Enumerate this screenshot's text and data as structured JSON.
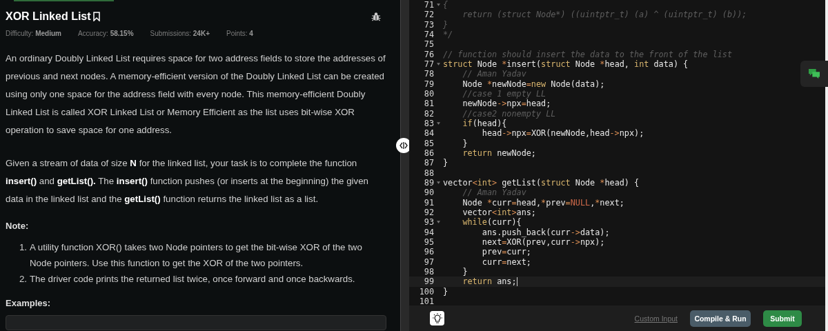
{
  "problem": {
    "title": "XOR Linked List",
    "stats": [
      {
        "label": "Difficulty:",
        "value": "Medium"
      },
      {
        "label": "Accuracy:",
        "value": "58.15%"
      },
      {
        "label": "Submissions:",
        "value": "24K+"
      },
      {
        "label": "Points:",
        "value": "4"
      }
    ],
    "paragraphs": [
      "An ordinary Doubly Linked List requires space for two address fields to store the addresses of previous and next nodes. A memory-efficient version of the Doubly Linked List can be created using only one space for the address field with every node. This memory-efficient Doubly Linked List is called XOR Linked List or Memory Efficient as the list uses bit-wise XOR operation to save space for one address.",
      "Given a stream of data of size **N** for the linked list, your task is to complete the function **insert()** and **getList().** The **insert()** function pushes (or inserts at the beginning) the given data in the linked list and the **getList()**  function returns the linked list as a list."
    ],
    "note_heading": "Note:",
    "notes": [
      {
        "marker": "1.",
        "text": "A utility function XOR() takes two Node pointers to get the bit-wise XOR of the two Node pointers. Use this function to get the XOR of the two pointers."
      },
      {
        "marker": "2.",
        "text": "The driver code prints the returned list twice, once forward and once backwards."
      }
    ],
    "examples_heading": "Examples:"
  },
  "editor": {
    "lines": [
      {
        "number": "71",
        "fold": true,
        "current": false,
        "tokens": [
          {
            "kind": "comment",
            "text": "{"
          }
        ]
      },
      {
        "number": "72",
        "fold": false,
        "current": false,
        "tokens": [
          {
            "kind": "comment",
            "text": "    return (struct Node*) ((uintptr_t) (a) ^ (uintptr_t) (b));"
          }
        ]
      },
      {
        "number": "73",
        "fold": false,
        "current": false,
        "tokens": [
          {
            "kind": "comment",
            "text": "}"
          }
        ]
      },
      {
        "number": "74",
        "fold": false,
        "current": false,
        "tokens": [
          {
            "kind": "comment",
            "text": "*/"
          }
        ]
      },
      {
        "number": "75",
        "fold": false,
        "current": false
      },
      {
        "number": "76",
        "fold": false,
        "current": false,
        "tokens": [
          {
            "kind": "comment",
            "text": "// function should insert the data to the front of the list"
          }
        ]
      },
      {
        "number": "77",
        "fold": true,
        "current": false,
        "tokens": [
          {
            "kind": "keyword",
            "text": "struct"
          },
          {
            "kind": "plain",
            "text": " Node "
          },
          {
            "kind": "operator",
            "text": "*"
          },
          {
            "kind": "plain",
            "text": "insert("
          },
          {
            "kind": "keyword",
            "text": "struct"
          },
          {
            "kind": "plain",
            "text": " Node "
          },
          {
            "kind": "operator",
            "text": "*"
          },
          {
            "kind": "plain",
            "text": "head, "
          },
          {
            "kind": "keyword",
            "text": "int"
          },
          {
            "kind": "plain",
            "text": " data) {"
          }
        ]
      },
      {
        "number": "78",
        "fold": false,
        "current": false,
        "tokens": [
          {
            "kind": "comment",
            "text": "    // Aman Yadav"
          }
        ]
      },
      {
        "number": "79",
        "fold": false,
        "current": false,
        "tokens": [
          {
            "kind": "plain",
            "text": "    Node "
          },
          {
            "kind": "operator",
            "text": "*"
          },
          {
            "kind": "plain",
            "text": "newNode"
          },
          {
            "kind": "operator",
            "text": "="
          },
          {
            "kind": "keyword",
            "text": "new"
          },
          {
            "kind": "plain",
            "text": " Node(data);"
          }
        ]
      },
      {
        "number": "80",
        "fold": false,
        "current": false,
        "tokens": [
          {
            "kind": "comment",
            "text": "    //case 1 empty LL"
          }
        ]
      },
      {
        "number": "81",
        "fold": false,
        "current": false,
        "tokens": [
          {
            "kind": "plain",
            "text": "    newNode"
          },
          {
            "kind": "operator",
            "text": "->"
          },
          {
            "kind": "plain",
            "text": "npx"
          },
          {
            "kind": "operator",
            "text": "="
          },
          {
            "kind": "plain",
            "text": "head;"
          }
        ]
      },
      {
        "number": "82",
        "fold": false,
        "current": false,
        "tokens": [
          {
            "kind": "comment",
            "text": "    //case2 nonempty LL"
          }
        ]
      },
      {
        "number": "83",
        "fold": true,
        "current": false,
        "tokens": [
          {
            "kind": "keyword",
            "text": "    if"
          },
          {
            "kind": "plain",
            "text": "(head){"
          }
        ]
      },
      {
        "number": "84",
        "fold": false,
        "current": false,
        "tokens": [
          {
            "kind": "plain",
            "text": "        head"
          },
          {
            "kind": "operator",
            "text": "->"
          },
          {
            "kind": "plain",
            "text": "npx"
          },
          {
            "kind": "operator",
            "text": "="
          },
          {
            "kind": "plain",
            "text": "XOR(newNode,head"
          },
          {
            "kind": "operator",
            "text": "->"
          },
          {
            "kind": "plain",
            "text": "npx);"
          }
        ]
      },
      {
        "number": "85",
        "fold": false,
        "current": false,
        "tokens": [
          {
            "kind": "plain",
            "text": "    }"
          }
        ]
      },
      {
        "number": "86",
        "fold": false,
        "current": false,
        "tokens": [
          {
            "kind": "keyword",
            "text": "    return"
          },
          {
            "kind": "plain",
            "text": " newNode;"
          }
        ]
      },
      {
        "number": "87",
        "fold": false,
        "current": false,
        "tokens": [
          {
            "kind": "plain",
            "text": "}"
          }
        ]
      },
      {
        "number": "88",
        "fold": false,
        "current": false
      },
      {
        "number": "89",
        "fold": true,
        "current": false,
        "tokens": [
          {
            "kind": "plain",
            "text": "vector"
          },
          {
            "kind": "operator",
            "text": "<"
          },
          {
            "kind": "keyword",
            "text": "int"
          },
          {
            "kind": "operator",
            "text": ">"
          },
          {
            "kind": "plain",
            "text": " getList("
          },
          {
            "kind": "keyword",
            "text": "struct"
          },
          {
            "kind": "plain",
            "text": " Node "
          },
          {
            "kind": "operator",
            "text": "*"
          },
          {
            "kind": "plain",
            "text": "head) {"
          }
        ]
      },
      {
        "number": "90",
        "fold": false,
        "current": false,
        "tokens": [
          {
            "kind": "comment",
            "text": "    // Aman Yadav"
          }
        ]
      },
      {
        "number": "91",
        "fold": false,
        "current": false,
        "tokens": [
          {
            "kind": "plain",
            "text": "    Node "
          },
          {
            "kind": "operator",
            "text": "*"
          },
          {
            "kind": "plain",
            "text": "curr"
          },
          {
            "kind": "operator",
            "text": "="
          },
          {
            "kind": "plain",
            "text": "head,"
          },
          {
            "kind": "operator",
            "text": "*"
          },
          {
            "kind": "plain",
            "text": "prev"
          },
          {
            "kind": "operator",
            "text": "="
          },
          {
            "kind": "constant",
            "text": "NULL"
          },
          {
            "kind": "plain",
            "text": ","
          },
          {
            "kind": "operator",
            "text": "*"
          },
          {
            "kind": "plain",
            "text": "next;"
          }
        ]
      },
      {
        "number": "92",
        "fold": false,
        "current": false,
        "tokens": [
          {
            "kind": "plain",
            "text": "    vector"
          },
          {
            "kind": "operator",
            "text": "<"
          },
          {
            "kind": "keyword",
            "text": "int"
          },
          {
            "kind": "operator",
            "text": ">"
          },
          {
            "kind": "plain",
            "text": "ans;"
          }
        ]
      },
      {
        "number": "93",
        "fold": true,
        "current": false,
        "tokens": [
          {
            "kind": "keyword",
            "text": "    while"
          },
          {
            "kind": "plain",
            "text": "(curr){"
          }
        ]
      },
      {
        "number": "94",
        "fold": false,
        "current": false,
        "tokens": [
          {
            "kind": "plain",
            "text": "        ans.push_back(curr"
          },
          {
            "kind": "operator",
            "text": "->"
          },
          {
            "kind": "plain",
            "text": "data);"
          }
        ]
      },
      {
        "number": "95",
        "fold": false,
        "current": false,
        "tokens": [
          {
            "kind": "plain",
            "text": "        next"
          },
          {
            "kind": "operator",
            "text": "="
          },
          {
            "kind": "plain",
            "text": "XOR(prev,curr"
          },
          {
            "kind": "operator",
            "text": "->"
          },
          {
            "kind": "plain",
            "text": "npx);"
          }
        ]
      },
      {
        "number": "96",
        "fold": false,
        "current": false,
        "tokens": [
          {
            "kind": "plain",
            "text": "        prev"
          },
          {
            "kind": "operator",
            "text": "="
          },
          {
            "kind": "plain",
            "text": "curr;"
          }
        ]
      },
      {
        "number": "97",
        "fold": false,
        "current": false,
        "tokens": [
          {
            "kind": "plain",
            "text": "        curr"
          },
          {
            "kind": "operator",
            "text": "="
          },
          {
            "kind": "plain",
            "text": "next;"
          }
        ]
      },
      {
        "number": "98",
        "fold": false,
        "current": false,
        "tokens": [
          {
            "kind": "plain",
            "text": "    }"
          }
        ]
      },
      {
        "number": "99",
        "fold": false,
        "current": true,
        "tokens": [
          {
            "kind": "keyword",
            "text": "    return"
          },
          {
            "kind": "plain",
            "text": " ans;"
          }
        ]
      },
      {
        "number": "100",
        "fold": false,
        "current": false,
        "tokens": [
          {
            "kind": "plain",
            "text": "}"
          }
        ]
      },
      {
        "number": "101",
        "fold": false,
        "current": false
      }
    ]
  },
  "footer": {
    "custom_input": "Custom Input",
    "compile": "Compile & Run",
    "submit": "Submit"
  }
}
